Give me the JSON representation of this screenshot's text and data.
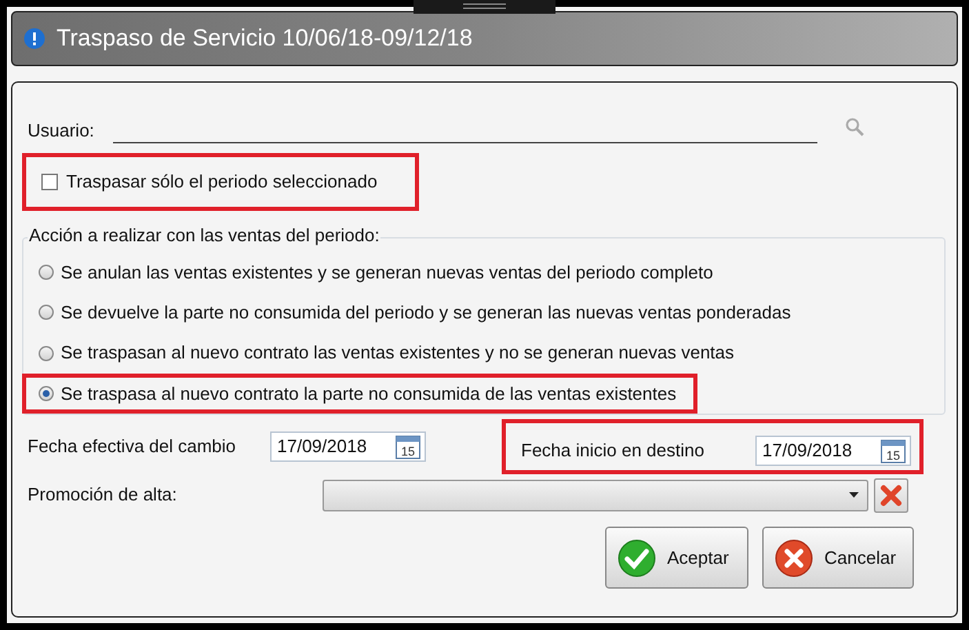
{
  "window": {
    "title": "Traspaso de Servicio 10/06/18-09/12/18"
  },
  "user_field": {
    "label": "Usuario:"
  },
  "transfer_only_selected": {
    "label": "Traspasar sólo el periodo seleccionado",
    "checked": false,
    "highlighted": true
  },
  "action_group": {
    "legend": "Acción a realizar con las ventas del periodo:",
    "options": [
      {
        "label": "Se anulan las ventas existentes y se generan nuevas ventas del periodo completo",
        "selected": false,
        "highlighted": false
      },
      {
        "label": "Se devuelve la parte no consumida del periodo y se generan las nuevas ventas ponderadas",
        "selected": false,
        "highlighted": false
      },
      {
        "label": "Se traspasan al nuevo contrato las ventas existentes y no se generan nuevas ventas",
        "selected": false,
        "highlighted": false
      },
      {
        "label": "Se traspasa al nuevo contrato la parte no consumida de las ventas existentes",
        "selected": true,
        "highlighted": true
      }
    ]
  },
  "dates": [
    {
      "label": "Fecha efectiva del cambio",
      "value": "17/09/2018",
      "calendar_day": "15",
      "highlighted": false
    },
    {
      "label": "Fecha inicio en destino",
      "value": "17/09/2018",
      "calendar_day": "15",
      "highlighted": true
    }
  ],
  "promotion": {
    "label": "Promoción de alta:"
  },
  "buttons": [
    {
      "label": "Aceptar",
      "kind": "accept"
    },
    {
      "label": "Cancelar",
      "kind": "cancel"
    }
  ]
}
